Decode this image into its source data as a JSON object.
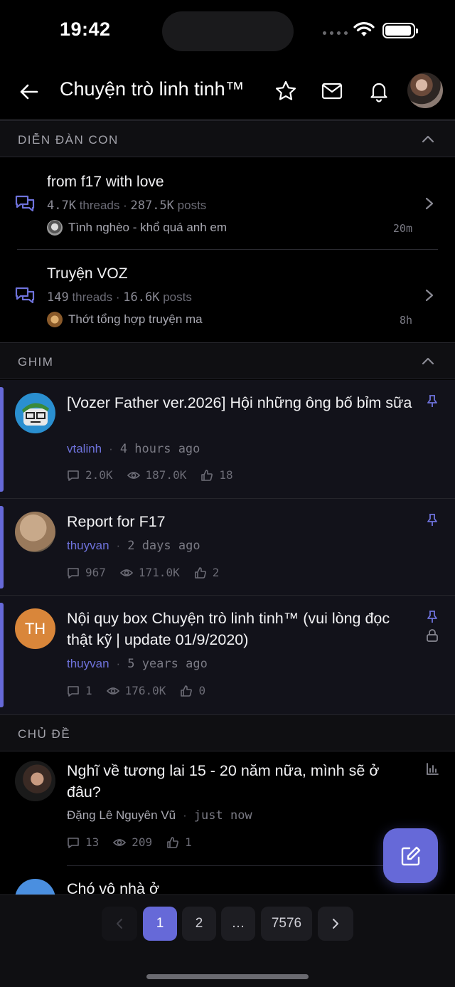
{
  "status": {
    "time": "19:42"
  },
  "header": {
    "title": "Chuyện trò linh tinh™"
  },
  "sections": {
    "subforums": "DIỄN ĐÀN CON",
    "pinned": "GHIM",
    "threads": "CHỦ ĐỀ"
  },
  "subforums": [
    {
      "title": "from f17 with love",
      "threads": "4.7K",
      "threads_label": "threads",
      "posts": "287.5K",
      "posts_label": "posts",
      "last_post": "Tình nghèo - khổ quá anh em",
      "time": "20m"
    },
    {
      "title": "Truyện VOZ",
      "threads": "149",
      "threads_label": "threads",
      "posts": "16.6K",
      "posts_label": "posts",
      "last_post": "Thớt tổng hợp truyện ma",
      "time": "8h"
    }
  ],
  "pinned": [
    {
      "title": "[Vozer Father ver.2026] Hội những ông bố bỉm sữa",
      "author": "vtalinh",
      "time": "4 hours ago",
      "replies": "2.0K",
      "views": "187.0K",
      "likes": "18"
    },
    {
      "title": "Report for F17",
      "author": "thuyvan",
      "time": "2 days ago",
      "replies": "967",
      "views": "171.0K",
      "likes": "2"
    },
    {
      "title": "Nội quy box Chuyện trò linh tinh™ (vui lòng đọc thật kỹ | update 01/9/2020)",
      "author": "thuyvan",
      "time": "5 years ago",
      "replies": "1",
      "views": "176.0K",
      "likes": "0",
      "avatar_initials": "TH"
    }
  ],
  "threads": [
    {
      "title": "Nghĩ về tương lai 15 - 20 năm nữa, mình sẽ ở đâu?",
      "author": "Đặng Lê Nguyên Vũ",
      "time": "just now",
      "replies": "13",
      "views": "209",
      "likes": "1"
    },
    {
      "title": "Chó vô nhà ở"
    }
  ],
  "pagination": {
    "pages": [
      "1",
      "2",
      "…",
      "7576"
    ],
    "current": "1"
  },
  "colors": {
    "accent": "#6669d8",
    "background": "#000000",
    "pinned_bg": "#12121a"
  }
}
